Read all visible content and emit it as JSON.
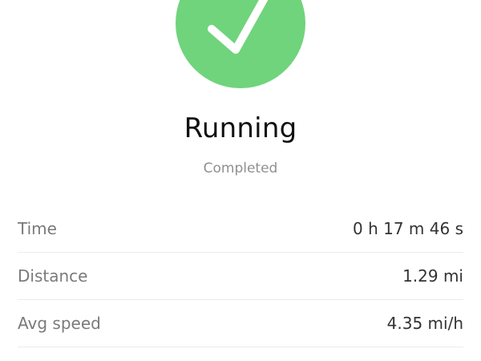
{
  "colors": {
    "accent": "#70d47c",
    "title": "#111111",
    "status": "#8f8f8f",
    "label": "#7a7a7a",
    "value": "#333333",
    "divider": "#ececec"
  },
  "icon": "checkmark-icon",
  "activity": {
    "title": "Running",
    "status": "Completed"
  },
  "stats": [
    {
      "label": "Time",
      "value": "0 h 17 m 46 s"
    },
    {
      "label": "Distance",
      "value": "1.29 mi"
    },
    {
      "label": "Avg speed",
      "value": "4.35 mi/h"
    }
  ]
}
